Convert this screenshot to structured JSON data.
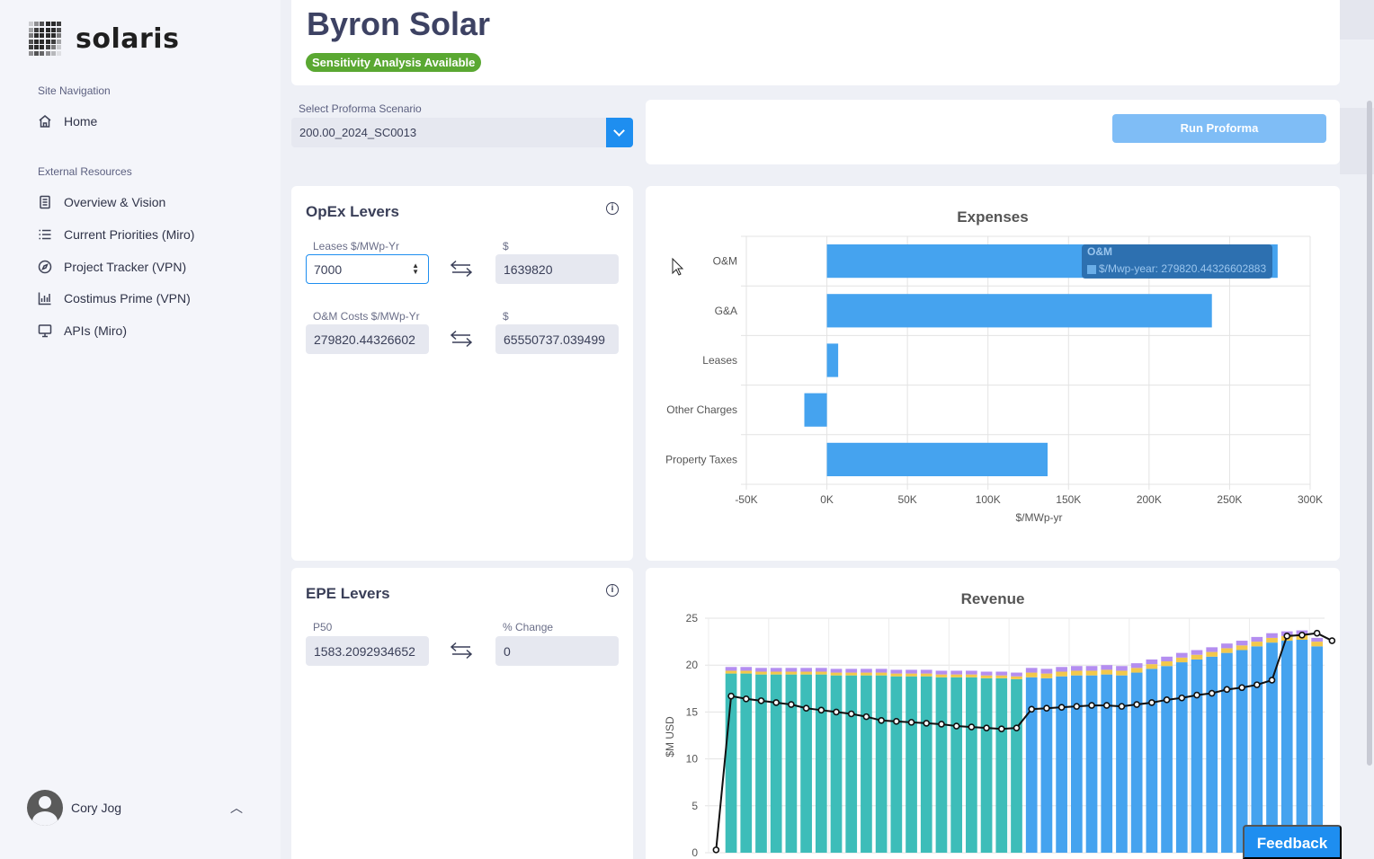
{
  "brand": {
    "name": "solaris"
  },
  "sidebar": {
    "site_nav_label": "Site Navigation",
    "home": "Home",
    "external_label": "External Resources",
    "items": [
      {
        "label": "Overview & Vision",
        "icon": "document-icon"
      },
      {
        "label": "Current Priorities (Miro)",
        "icon": "list-icon"
      },
      {
        "label": "Project Tracker (VPN)",
        "icon": "compass-icon"
      },
      {
        "label": "Costimus Prime (VPN)",
        "icon": "bar-chart-icon"
      },
      {
        "label": "APIs (Miro)",
        "icon": "monitor-icon"
      }
    ],
    "user": "Cory Jog"
  },
  "header": {
    "title": "Byron Solar",
    "badge": "Sensitivity Analysis Available"
  },
  "scenario": {
    "label": "Select Proforma Scenario",
    "value": "200.00_2024_SC0013"
  },
  "run_button": "Run Proforma",
  "opex": {
    "title": "OpEx Levers",
    "leases_label": "Leases $/MWp-Yr",
    "leases_value": "7000",
    "leases_dollar_label": "$",
    "leases_dollar_value": "1639820",
    "om_label": "O&M Costs $/MWp-Yr",
    "om_value": "279820.44326602",
    "om_dollar_label": "$",
    "om_dollar_value": "65550737.039499"
  },
  "epe": {
    "title": "EPE Levers",
    "p50_label": "P50",
    "p50_value": "1583.2092934652",
    "change_label": "% Change",
    "change_value": "0"
  },
  "feedback": "Feedback",
  "colors": {
    "accent": "#1e8ef0",
    "badge": "#5aa832",
    "teal": "#3dbdb9",
    "blue": "#45a3ef",
    "yellow": "#f2c84b",
    "purple": "#b48ef0"
  },
  "chart_data": [
    {
      "type": "bar",
      "orientation": "horizontal",
      "title": "Expenses",
      "xlabel": "$/MWp-yr",
      "categories": [
        "O&M",
        "G&A",
        "Leases",
        "Other Charges",
        "Property Taxes"
      ],
      "values": [
        279820.44,
        239000,
        7000,
        -14000,
        137000
      ],
      "xlim": [
        -50000,
        300000
      ],
      "xticks": [
        "-50K",
        "0K",
        "50K",
        "100K",
        "150K",
        "200K",
        "250K",
        "300K"
      ],
      "tooltip": {
        "title": "O&M",
        "text": "$/Mwp-year: 279820.44326602883"
      }
    },
    {
      "type": "bar",
      "stacked": true,
      "title": "Revenue",
      "ylabel": "$M USD",
      "ylim": [
        0,
        25
      ],
      "yticks": [
        "0",
        "5",
        "10",
        "15",
        "20",
        "25"
      ],
      "bars": [
        [
          0,
          0,
          0,
          0
        ],
        [
          19.1,
          0,
          0.3,
          0.4
        ],
        [
          19.1,
          0,
          0.3,
          0.4
        ],
        [
          19.0,
          0,
          0.3,
          0.4
        ],
        [
          19.0,
          0,
          0.3,
          0.4
        ],
        [
          19.0,
          0,
          0.3,
          0.4
        ],
        [
          19.0,
          0,
          0.3,
          0.4
        ],
        [
          19.0,
          0,
          0.3,
          0.4
        ],
        [
          18.9,
          0,
          0.3,
          0.4
        ],
        [
          18.9,
          0,
          0.3,
          0.4
        ],
        [
          18.9,
          0,
          0.3,
          0.4
        ],
        [
          18.9,
          0,
          0.3,
          0.4
        ],
        [
          18.8,
          0,
          0.3,
          0.4
        ],
        [
          18.8,
          0,
          0.3,
          0.4
        ],
        [
          18.8,
          0,
          0.3,
          0.4
        ],
        [
          18.7,
          0,
          0.3,
          0.4
        ],
        [
          18.7,
          0,
          0.3,
          0.4
        ],
        [
          18.7,
          0,
          0.3,
          0.4
        ],
        [
          18.6,
          0,
          0.3,
          0.4
        ],
        [
          18.6,
          0,
          0.3,
          0.4
        ],
        [
          18.5,
          0,
          0.3,
          0.4
        ],
        [
          0,
          18.7,
          0.5,
          0.5
        ],
        [
          0,
          18.6,
          0.5,
          0.5
        ],
        [
          0,
          18.8,
          0.5,
          0.5
        ],
        [
          0,
          18.9,
          0.5,
          0.5
        ],
        [
          0,
          18.9,
          0.5,
          0.5
        ],
        [
          0,
          19.0,
          0.5,
          0.5
        ],
        [
          0,
          18.9,
          0.5,
          0.5
        ],
        [
          0,
          19.2,
          0.5,
          0.5
        ],
        [
          0,
          19.6,
          0.5,
          0.5
        ],
        [
          0,
          19.9,
          0.5,
          0.5
        ],
        [
          0,
          20.3,
          0.5,
          0.5
        ],
        [
          0,
          20.6,
          0.5,
          0.5
        ],
        [
          0,
          20.9,
          0.5,
          0.5
        ],
        [
          0,
          21.3,
          0.5,
          0.5
        ],
        [
          0,
          21.6,
          0.5,
          0.5
        ],
        [
          0,
          22.0,
          0.5,
          0.5
        ],
        [
          0,
          22.4,
          0.5,
          0.5
        ],
        [
          0,
          22.6,
          0.5,
          0.5
        ],
        [
          0,
          22.7,
          0.5,
          0.5
        ],
        [
          0,
          22.0,
          0.5,
          0.4
        ]
      ],
      "line": [
        0.3,
        16.7,
        16.4,
        16.2,
        16.0,
        15.8,
        15.4,
        15.2,
        15.0,
        14.8,
        14.5,
        14.1,
        14.0,
        13.9,
        13.8,
        13.7,
        13.5,
        13.4,
        13.3,
        13.2,
        13.3,
        15.3,
        15.4,
        15.5,
        15.6,
        15.7,
        15.7,
        15.6,
        15.8,
        16.0,
        16.3,
        16.5,
        16.8,
        17.0,
        17.4,
        17.6,
        17.9,
        18.4,
        23.1,
        23.2,
        23.4,
        22.6
      ]
    }
  ]
}
